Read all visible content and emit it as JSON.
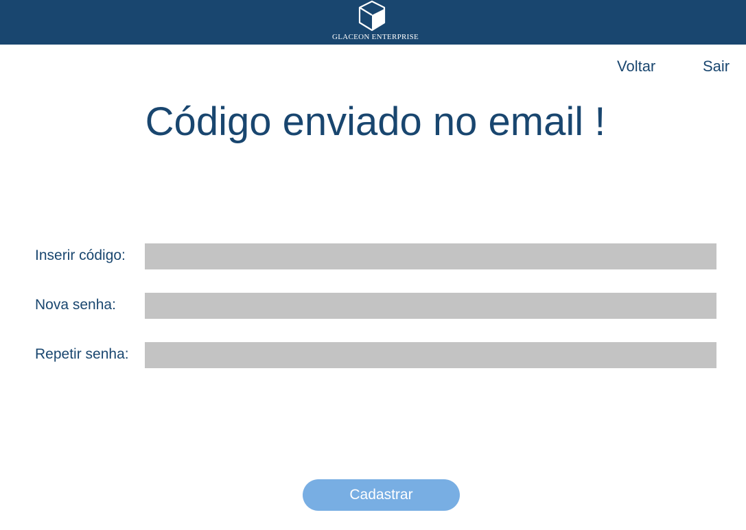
{
  "header": {
    "logo_icon": "cube-icon",
    "brand_name": "GLACEON ENTERPRISE",
    "background_color": "#19466f"
  },
  "nav": {
    "back_label": "Voltar",
    "exit_label": "Sair"
  },
  "page": {
    "title": "Código enviado no email !"
  },
  "form": {
    "code_label": "Inserir código:",
    "code_value": "",
    "new_password_label": "Nova senha:",
    "new_password_value": "",
    "repeat_password_label": "Repetir senha:",
    "repeat_password_value": "",
    "input_color": "#c3c3c3",
    "submit_label": "Cadastrar",
    "submit_color": "#78aee3"
  }
}
